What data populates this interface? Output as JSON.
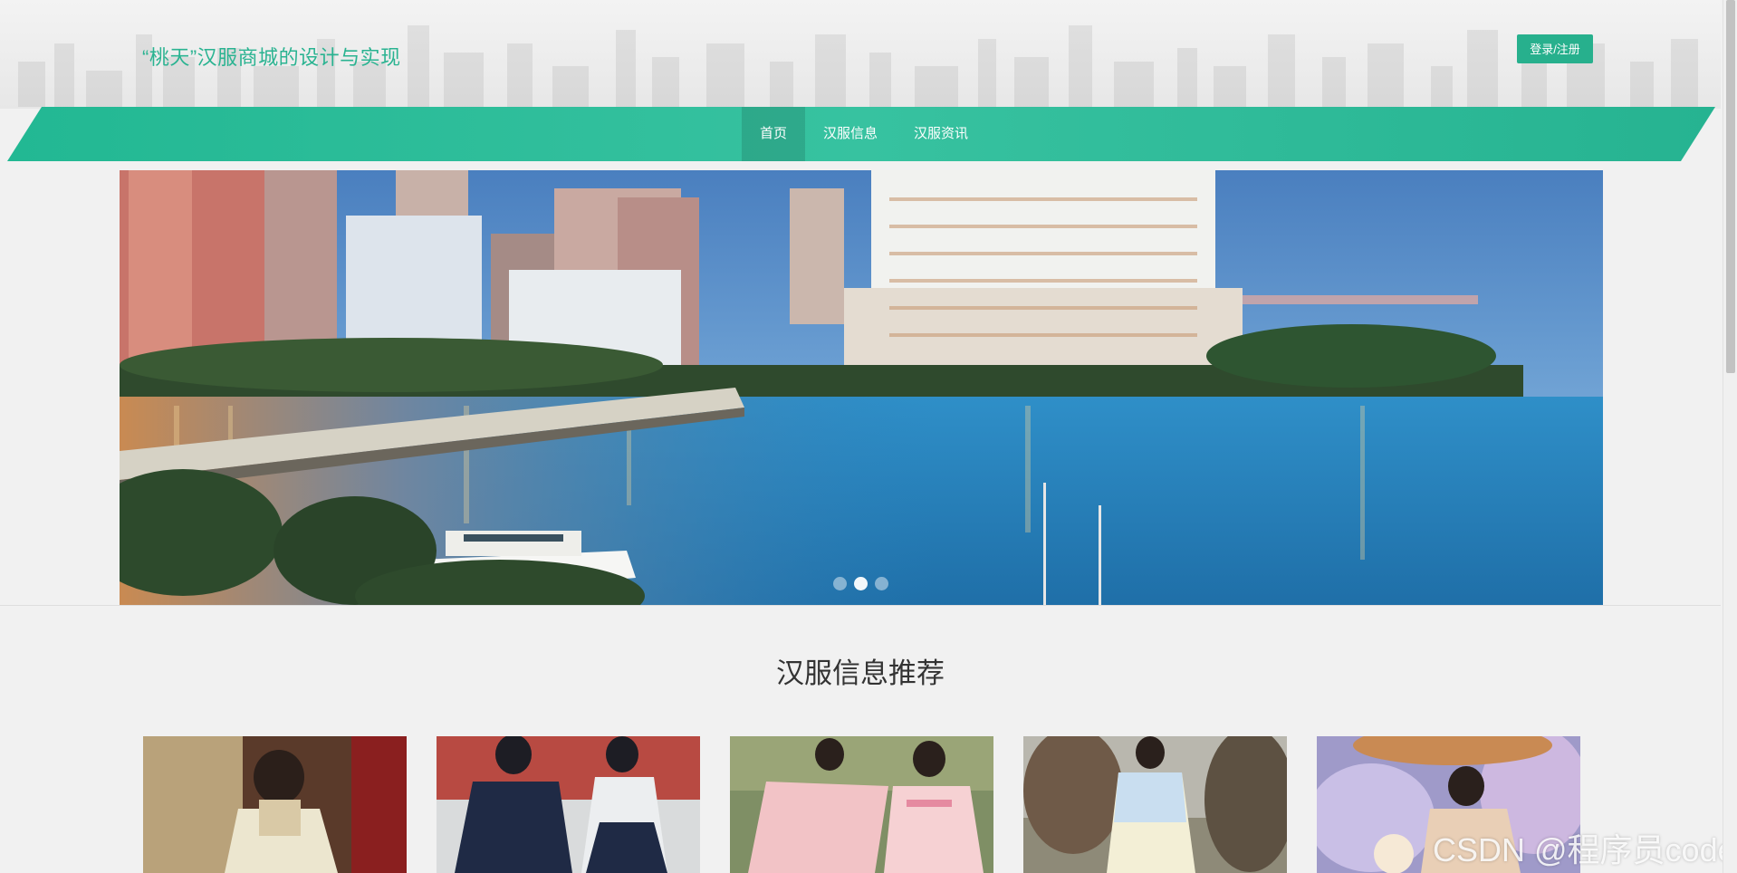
{
  "header": {
    "title": "“桃天”汉服商城的设计与实现",
    "login_label": "登录/注册"
  },
  "nav": {
    "items": [
      {
        "label": "首页",
        "active": true
      },
      {
        "label": "汉服信息",
        "active": false
      },
      {
        "label": "汉服资讯",
        "active": false
      }
    ]
  },
  "carousel": {
    "next_glyph": "›",
    "slide_count": 3,
    "active_index": 1
  },
  "section": {
    "title": "汉服信息推荐"
  },
  "watermark": "CSDN @程序员code",
  "colors": {
    "accent": "#27b08d",
    "title_green": "#2ab391"
  }
}
